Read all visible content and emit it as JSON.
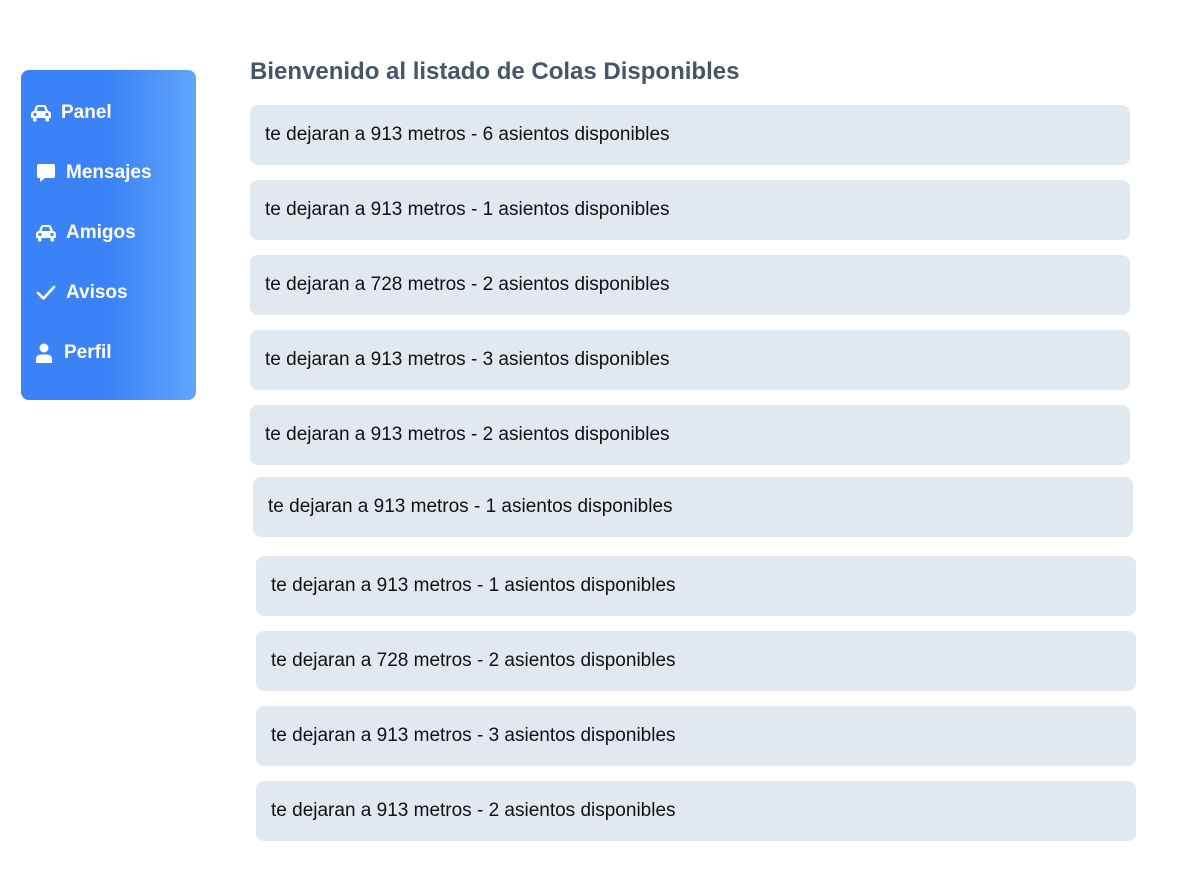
{
  "sidebar": {
    "items": [
      {
        "label": "Panel",
        "icon": "car-icon"
      },
      {
        "label": "Mensajes",
        "icon": "message-icon"
      },
      {
        "label": "Amigos",
        "icon": "car-icon"
      },
      {
        "label": "Avisos",
        "icon": "check-icon"
      },
      {
        "label": "Perfil",
        "icon": "user-icon"
      }
    ]
  },
  "main": {
    "title": "Bienvenido al listado de Colas Disponibles",
    "rides": [
      "te dejaran a 913 metros - 6 asientos disponibles",
      "te dejaran a 913 metros - 1 asientos disponibles",
      "te dejaran a 728 metros - 2 asientos disponibles",
      "te dejaran a 913 metros - 3 asientos disponibles",
      "te dejaran a 913 metros - 2 asientos disponibles",
      "te dejaran a 913 metros - 1 asientos disponibles",
      "te dejaran a 913 metros - 1 asientos disponibles",
      "te dejaran a 728 metros - 2 asientos disponibles",
      "te dejaran a 913 metros - 3 asientos disponibles",
      "te dejaran a 913 metros - 2 asientos disponibles"
    ]
  },
  "colors": {
    "sidebar_start": "#3b82f6",
    "sidebar_end": "#60a5fa",
    "row_bg": "#e2e8f0",
    "title": "#475569"
  }
}
